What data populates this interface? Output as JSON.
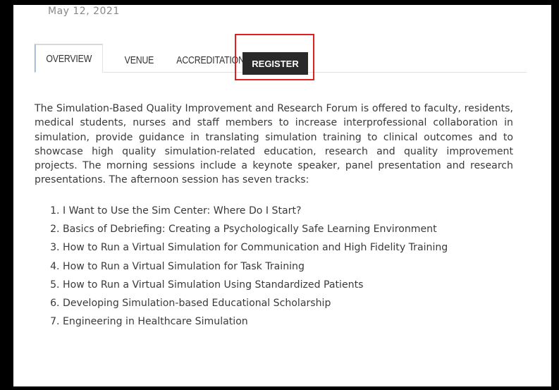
{
  "event": {
    "date": "May 12, 2021"
  },
  "tabs": [
    {
      "label": "OVERVIEW",
      "active": true
    },
    {
      "label": "VENUE",
      "active": false
    },
    {
      "label": "ACCREDITATION",
      "active": false
    },
    {
      "label": "REGISTER",
      "active": false
    }
  ],
  "overview": {
    "description": "The Simulation-Based Quality Improvement and Research Forum is offered to faculty, residents, medical students, nurses and staff members to increase interprofessional collaboration in simulation, provide guidance in translating simulation training to clinical outcomes and to showcase high quality simulation-related education, research and quality improvement projects. The morning sessions include a keynote speaker, panel presentation and research presentations. The afternoon session has seven tracks:",
    "tracks": [
      "I Want to Use the Sim Center: Where Do I Start?",
      "Basics of Debriefing: Creating a Psychologically Safe Learning Environment",
      "How to Run a Virtual Simulation for Communication and High Fidelity Training",
      "How to Run a Virtual Simulation for Task Training",
      "How to Run a Virtual Simulation Using Standardized Patients",
      "Developing Simulation-based Educational Scholarship",
      "Engineering in Healthcare Simulation"
    ]
  },
  "colors": {
    "register_tab_bg": "#2a2a2a",
    "highlight_border": "#e02020",
    "active_tab_accent": "#8ab4d8",
    "body_text": "#3a3a3a"
  }
}
